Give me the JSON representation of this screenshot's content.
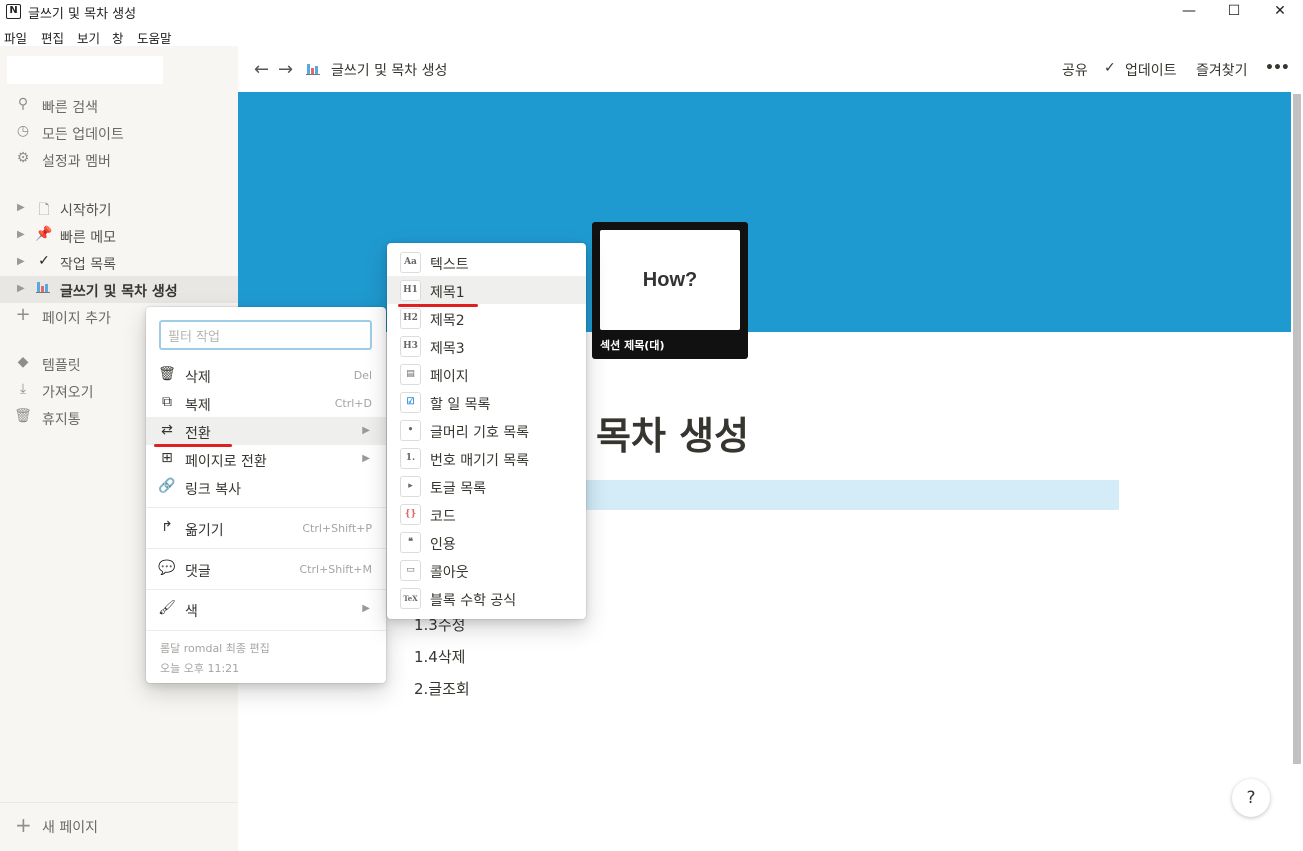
{
  "window": {
    "title": "글쓰기 및 목차 생성",
    "app_icon": "N",
    "minimize": "—",
    "maximize": "☐",
    "close": "✕"
  },
  "menubar": [
    "파일",
    "편집",
    "보기",
    "창",
    "도움말"
  ],
  "sidebar": {
    "top_items": [
      {
        "label": "빠른 검색",
        "icon": "search-icon"
      },
      {
        "label": "모든 업데이트",
        "icon": "clock-icon"
      },
      {
        "label": "설정과 멤버",
        "icon": "gear-icon"
      }
    ],
    "pages": [
      {
        "label": "시작하기",
        "icon": "document-icon"
      },
      {
        "label": "빠른 메모",
        "icon": "pushpin-icon"
      },
      {
        "label": "작업 목록",
        "icon": "checkmark-icon"
      },
      {
        "label": "글쓰기 및 목차 생성",
        "icon": "chart-icon"
      }
    ],
    "add_page": "페이지 추가",
    "bottom_items": [
      {
        "label": "템플릿",
        "icon": "shapes-icon"
      },
      {
        "label": "가져오기",
        "icon": "download-icon"
      },
      {
        "label": "휴지통",
        "icon": "trash-icon"
      }
    ],
    "new_page": "새 페이지"
  },
  "topbar": {
    "breadcrumb": "글쓰기 및 목차 생성",
    "share": "공유",
    "updates": "업데이트",
    "favorites": "즐겨찾기",
    "more": "•••"
  },
  "page": {
    "title_visible": "목차 생성",
    "toc": [
      "1.3수정",
      "1.4삭제",
      "2.글조회"
    ],
    "help": "?"
  },
  "preview": {
    "card_text": "How?",
    "caption": "섹션 제목(대)"
  },
  "context_menu": {
    "filter_placeholder": "필터 작업",
    "items": [
      {
        "label": "삭제",
        "shortcut": "Del",
        "icon": "trash-icon"
      },
      {
        "label": "복제",
        "shortcut": "Ctrl+D",
        "icon": "duplicate-icon"
      },
      {
        "label": "전환",
        "submenu": "▶",
        "icon": "swap-icon"
      },
      {
        "label": "페이지로 전환",
        "submenu": "▶",
        "icon": "plus-box-icon"
      },
      {
        "label": "링크 복사",
        "icon": "link-icon"
      },
      {
        "label": "옮기기",
        "shortcut": "Ctrl+Shift+P",
        "icon": "move-arrow-icon"
      },
      {
        "label": "댓글",
        "shortcut": "Ctrl+Shift+M",
        "icon": "comment-icon"
      },
      {
        "label": "색",
        "submenu": "▶",
        "icon": "paint-roller-icon"
      }
    ],
    "last_edited_by": "롬달 romdal 최종 편집",
    "last_edited_time": "오늘 오후 11:21"
  },
  "turn_into_menu": {
    "items": [
      {
        "label": "텍스트",
        "thumb": "Aa"
      },
      {
        "label": "제목1",
        "thumb": "H1"
      },
      {
        "label": "제목2",
        "thumb": "H2"
      },
      {
        "label": "제목3",
        "thumb": "H3"
      },
      {
        "label": "페이지",
        "thumb": "▤"
      },
      {
        "label": "할 일 목록",
        "thumb": "☑"
      },
      {
        "label": "글머리 기호 목록",
        "thumb": "•"
      },
      {
        "label": "번호 매기기 목록",
        "thumb": "1."
      },
      {
        "label": "토글 목록",
        "thumb": "▸"
      },
      {
        "label": "코드",
        "thumb": "{}"
      },
      {
        "label": "인용",
        "thumb": "❝"
      },
      {
        "label": "콜아웃",
        "thumb": "▭"
      },
      {
        "label": "블록 수학 공식",
        "thumb": "TeX"
      }
    ]
  },
  "colors": {
    "cover": "#1f9ad0",
    "highlight": "#d3ecf8",
    "annotation_red": "#e0201f"
  }
}
